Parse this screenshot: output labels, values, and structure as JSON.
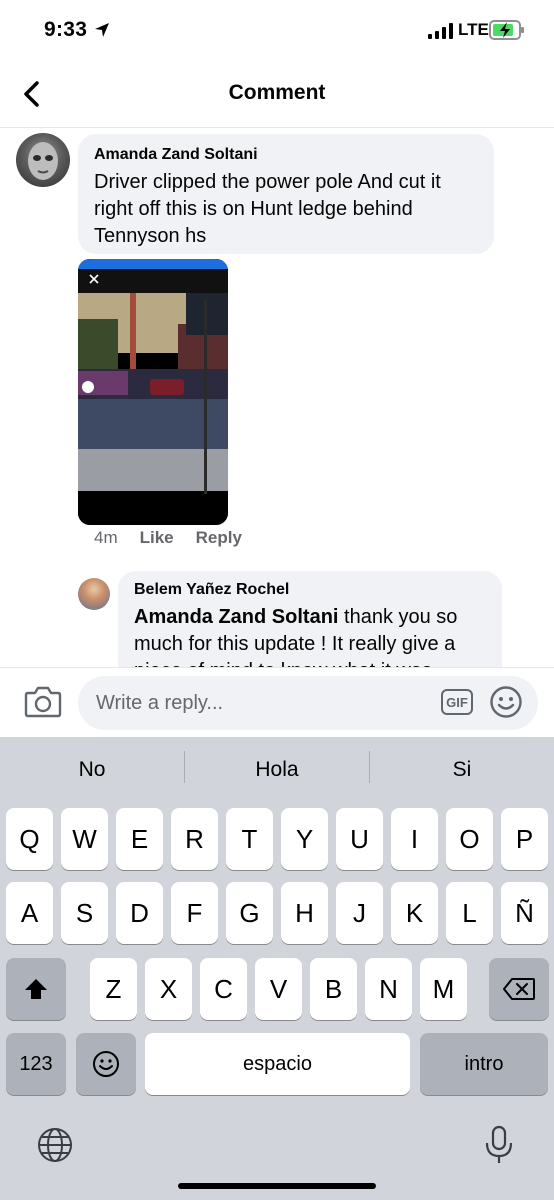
{
  "status_bar": {
    "time": "9:33",
    "network": "LTE"
  },
  "header": {
    "title": "Comment"
  },
  "comment": {
    "author": "Amanda Zand Soltani",
    "text": "Driver clipped the power pole And cut it right off this is on Hunt ledge behind Tennyson hs",
    "time_ago": "4m",
    "like_label": "Like",
    "reply_label": "Reply"
  },
  "reply": {
    "author": "Belem Yañez Rochel",
    "mention": "Amanda Zand Soltani",
    "text": " thank you so much for this update ! It really give a piece of mind to know what it was"
  },
  "composer": {
    "placeholder": "Write a reply...",
    "gif_label": "GIF"
  },
  "keyboard": {
    "suggestions": [
      "No",
      "Hola",
      "Si"
    ],
    "row1": [
      "Q",
      "W",
      "E",
      "R",
      "T",
      "Y",
      "U",
      "I",
      "O",
      "P"
    ],
    "row2": [
      "A",
      "S",
      "D",
      "F",
      "G",
      "H",
      "J",
      "K",
      "L",
      "Ñ"
    ],
    "row3": [
      "Z",
      "X",
      "C",
      "V",
      "B",
      "N",
      "M"
    ],
    "numbers_label": "123",
    "space_label": "espacio",
    "return_label": "intro"
  },
  "icons": {
    "back": "chevron-left-icon",
    "camera": "camera-icon",
    "emoji": "smiley-icon",
    "shift": "shift-icon",
    "delete": "backspace-icon",
    "globe": "globe-icon",
    "mic": "microphone-icon"
  },
  "colors": {
    "bubble": "#f0f2f5",
    "keyboard": "#d1d4da",
    "battery": "#4cd964"
  }
}
